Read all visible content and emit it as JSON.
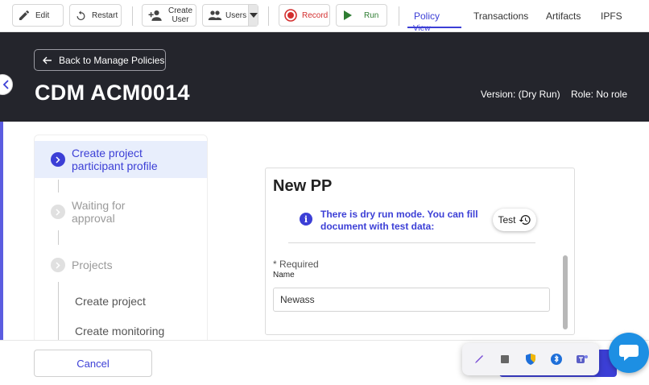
{
  "toolbar": {
    "edit_label": "Edit",
    "restart_label": "Restart",
    "create_user_line1": "Create",
    "create_user_line2": "User",
    "users_label": "Users",
    "record_label": "Record",
    "run_label": "Run"
  },
  "nav_tabs": [
    {
      "label": "Policy",
      "sub": "View"
    },
    {
      "label": "Transactions"
    },
    {
      "label": "Artifacts"
    },
    {
      "label": "IPFS"
    }
  ],
  "header": {
    "back_label": "Back to Manage Policies",
    "title": "CDM ACM0014",
    "version": "Version: (Dry Run)",
    "role": "Role: No role"
  },
  "steps": [
    {
      "line1": "Create project",
      "line2": "participant profile",
      "state": "active"
    },
    {
      "line1": "Waiting for",
      "line2": "approval",
      "state": "inactive"
    },
    {
      "line1": "Projects",
      "line2": "",
      "state": "inactive"
    }
  ],
  "substeps": [
    "Create project",
    "Create monitoring"
  ],
  "form": {
    "title": "New PP",
    "info_line1": "There is dry run mode. You can fill",
    "info_line2": "document with test data:",
    "test_label": "Test",
    "required": "* Required",
    "name_label": "Name",
    "name_value": "Newass"
  },
  "footer": {
    "cancel_label": "Cancel"
  },
  "colors": {
    "accent": "#3c3fd6",
    "header_bg": "#24252c",
    "record_red": "#d32f2f",
    "run_green": "#2e7d32"
  }
}
